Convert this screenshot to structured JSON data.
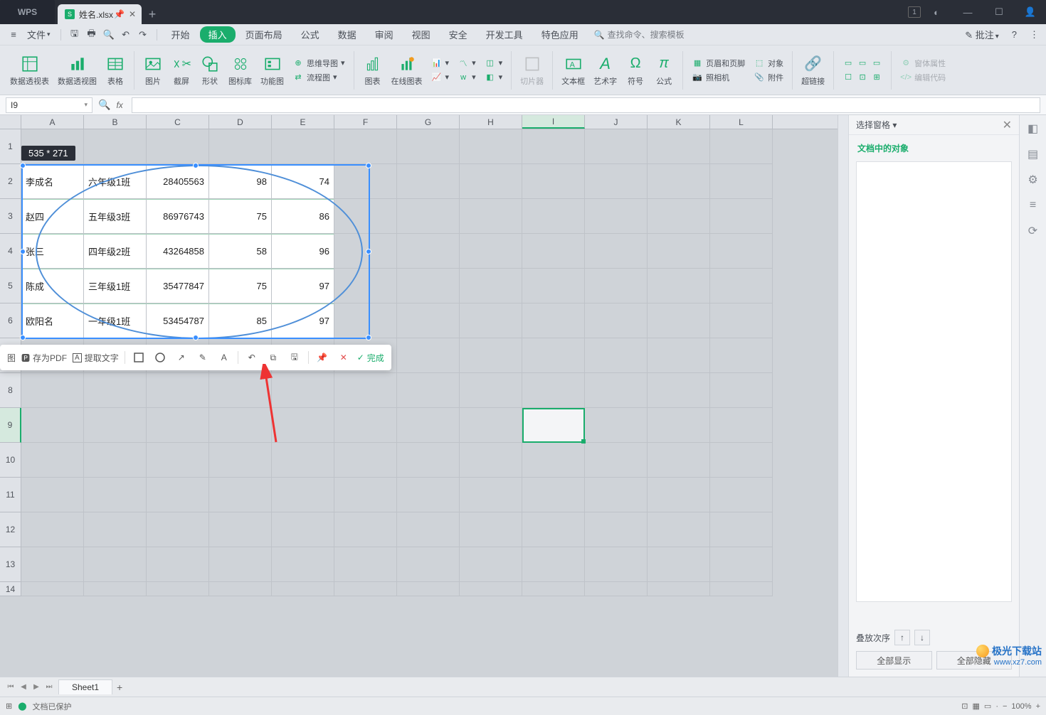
{
  "app": {
    "name": "WPS",
    "file_name": "姓名.xlsx"
  },
  "window_controls": {
    "badge": "1"
  },
  "file_menu": {
    "label": "文件"
  },
  "menu_tabs": [
    "开始",
    "插入",
    "页面布局",
    "公式",
    "数据",
    "审阅",
    "视图",
    "安全",
    "开发工具",
    "特色应用"
  ],
  "menu_active": "插入",
  "search": {
    "placeholder": "查找命令、搜索模板",
    "icon": "🔍"
  },
  "annotate_btn": "批注",
  "ribbon": {
    "pivot_table": "数据透视表",
    "pivot_chart": "数据透视图",
    "table": "表格",
    "image": "图片",
    "screenshot": "截屏",
    "shapes": "形状",
    "icon_lib": "图标库",
    "function_chart": "功能图",
    "mindmap": "思维导图",
    "flowchart": "流程图",
    "chart": "图表",
    "online_chart": "在线图表",
    "slicer": "切片器",
    "textbox": "文本框",
    "wordart": "艺术字",
    "symbol": "符号",
    "equation": "公式",
    "header_footer": "页眉和页脚",
    "object": "对象",
    "camera": "照相机",
    "attachment": "附件",
    "hyperlink": "超链接",
    "form_attr": "窗体属性",
    "edit_code": "编辑代码"
  },
  "cell_reference": "I9",
  "columns": [
    "A",
    "B",
    "C",
    "D",
    "E",
    "F",
    "G",
    "H",
    "I",
    "J",
    "K",
    "L"
  ],
  "col_sel": "I",
  "rows_visible": 14,
  "row_sel": 9,
  "table_data": [
    {
      "name": "李成名",
      "class": "六年级1班",
      "id": "28405563",
      "score1": "98",
      "score2": "74"
    },
    {
      "name": "赵四",
      "class": "五年级3班",
      "id": "86976743",
      "score1": "75",
      "score2": "86"
    },
    {
      "name": "张三",
      "class": "四年级2班",
      "id": "43264858",
      "score1": "58",
      "score2": "96"
    },
    {
      "name": "陈成",
      "class": "三年级1班",
      "id": "35477847",
      "score1": "75",
      "score2": "97"
    },
    {
      "name": "欧阳名",
      "class": "一年级1班",
      "id": "53454787",
      "score1": "85",
      "score2": "97"
    }
  ],
  "screenshot": {
    "badge": "535 * 271",
    "toolbar": {
      "save_pdf": "存为PDF",
      "extract_text": "提取文字",
      "done": "完成"
    }
  },
  "right_panel": {
    "title": "选择窗格",
    "section": "文档中的对象",
    "zorder": "叠放次序",
    "show_all": "全部显示",
    "hide_all": "全部隐藏"
  },
  "sheet_tab": "Sheet1",
  "status": {
    "protection": "文档已保护",
    "zoom": "100%"
  },
  "watermark": {
    "brand": "极光下载站",
    "url": "www.xz7.com"
  },
  "shot_first_btn": "图"
}
